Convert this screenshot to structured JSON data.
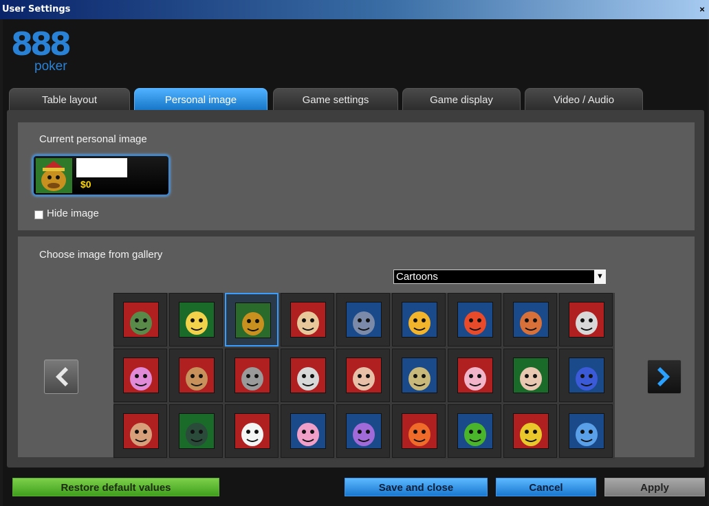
{
  "window": {
    "title": "User Settings",
    "close_label": "×"
  },
  "logo": {
    "number": "888",
    "word": "poker"
  },
  "tabs": [
    {
      "label": "Table layout",
      "active": false
    },
    {
      "label": "Personal image",
      "active": true
    },
    {
      "label": "Game settings",
      "active": false
    },
    {
      "label": "Game display",
      "active": false
    },
    {
      "label": "Video / Audio",
      "active": false
    }
  ],
  "current": {
    "heading": "Current personal image",
    "money": "$0",
    "hide_label": "Hide image",
    "hide_checked": false
  },
  "gallery": {
    "heading": "Choose image from gallery",
    "category": "Cartoons",
    "selected_index": 2,
    "avatars": [
      "Eyepatch thug",
      "Blonde woman",
      "Viking dog",
      "Long-haired elf",
      "Shark",
      "Yellow fish",
      "Rooster",
      "Fox",
      "Wizard",
      "Pink-haired lady",
      "Pirate",
      "Hooded witch",
      "Knight",
      "Red-haired woman",
      "Turbaned man",
      "Fairy",
      "Glasses nerd",
      "Blue monster",
      "Police officer",
      "Crow",
      "Eagle",
      "Pink pig",
      "Purple octopus",
      "Orange fish",
      "Green frog",
      "Jester",
      "Blue shark"
    ]
  },
  "footer": {
    "restore": "Restore default values",
    "save": "Save and close",
    "cancel": "Cancel",
    "apply": "Apply"
  },
  "colors": {
    "accent": "#1a78d0",
    "restore_green": "#3f9f1e",
    "money": "#ffd800"
  }
}
